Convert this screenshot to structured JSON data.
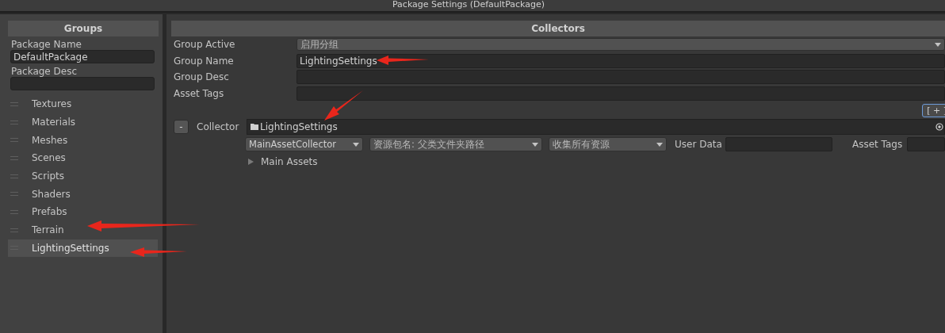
{
  "window": {
    "title": "Package Settings (DefaultPackage)"
  },
  "groups_panel": {
    "header": "Groups",
    "package_name_label": "Package Name",
    "package_name": "DefaultPackage",
    "package_desc_label": "Package Desc",
    "items": [
      {
        "label": "Textures",
        "selected": false
      },
      {
        "label": "Materials",
        "selected": false
      },
      {
        "label": "Meshes",
        "selected": false
      },
      {
        "label": "Scenes",
        "selected": false
      },
      {
        "label": "Scripts",
        "selected": false
      },
      {
        "label": "Shaders",
        "selected": false
      },
      {
        "label": "Prefabs",
        "selected": false
      },
      {
        "label": "Terrain",
        "selected": false
      },
      {
        "label": "LightingSettings",
        "selected": true
      }
    ]
  },
  "collectors_panel": {
    "header": "Collectors",
    "fields": [
      {
        "label": "Group Active",
        "kind": "dropdown",
        "value": "启用分组"
      },
      {
        "label": "Group Name",
        "kind": "text",
        "value": "LightingSettings"
      },
      {
        "label": "Group Desc",
        "kind": "text"
      },
      {
        "label": "Asset Tags",
        "kind": "text"
      }
    ],
    "add_button": "[ + ]",
    "collector": {
      "remove_button": "-",
      "label": "Collector",
      "path": "LightingSettings",
      "collector_type": "MainAssetCollector",
      "address_rule": "资源包名: 父类文件夹路径",
      "filter_rule": "收集所有资源",
      "user_data_label": "User Data",
      "asset_tags_label": "Asset Tags",
      "main_assets": {
        "label": "Main Assets",
        "expanded": false
      }
    }
  }
}
